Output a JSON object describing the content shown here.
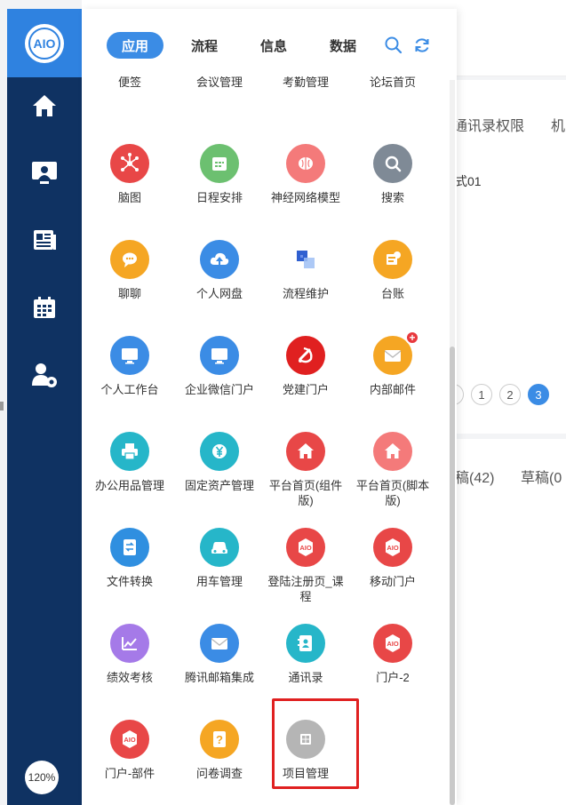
{
  "sidebar": {
    "logo_text": "AIO",
    "nav_icons": [
      "home-icon",
      "monitor-user-icon",
      "news-icon",
      "calendar-icon",
      "user-settings-icon"
    ],
    "zoom_label": "120%"
  },
  "panel": {
    "tabs": [
      {
        "label": "应用",
        "active": true
      },
      {
        "label": "流程",
        "active": false
      },
      {
        "label": "信息",
        "active": false
      },
      {
        "label": "数据",
        "active": false
      }
    ],
    "header_icons": [
      "search-icon",
      "refresh-icon"
    ],
    "apps": [
      {
        "label": "便签",
        "color": "#e8a13a",
        "icon": "note-icon"
      },
      {
        "label": "会议管理",
        "color": "#f2a93b",
        "icon": "meeting-icon"
      },
      {
        "label": "考勤管理",
        "color": "#f2a93b",
        "icon": "attendance-icon"
      },
      {
        "label": "论坛首页",
        "color": "#3fb4e8",
        "icon": "forum-icon"
      },
      {
        "label": "脑图",
        "color": "#e84747",
        "icon": "mindmap-icon"
      },
      {
        "label": "日程安排",
        "color": "#6cc070",
        "icon": "schedule-icon"
      },
      {
        "label": "神经网络模型",
        "color": "#f47a7a",
        "icon": "brain-icon"
      },
      {
        "label": "搜索",
        "color": "#7f8a96",
        "icon": "search-icon"
      },
      {
        "label": "聊聊",
        "color": "#f5a623",
        "icon": "chat-icon"
      },
      {
        "label": "个人网盘",
        "color": "#3b8ce5",
        "icon": "cloud-upload-icon"
      },
      {
        "label": "流程维护",
        "color": "transparent",
        "icon": "flow-squares-icon"
      },
      {
        "label": "台账",
        "color": "#f5a623",
        "icon": "ledger-icon"
      },
      {
        "label": "个人工作台",
        "color": "#3b8ce5",
        "icon": "monitor-icon"
      },
      {
        "label": "企业微信门户",
        "color": "#3b8ce5",
        "icon": "monitor-icon"
      },
      {
        "label": "党建门户",
        "color": "#e02020",
        "icon": "party-emblem-icon"
      },
      {
        "label": "内部邮件",
        "color": "#f5a623",
        "icon": "mail-icon",
        "badge": "+"
      },
      {
        "label": "办公用品管理",
        "color": "#26b6c9",
        "icon": "printer-icon"
      },
      {
        "label": "固定资产管理",
        "color": "#26b6c9",
        "icon": "yen-icon"
      },
      {
        "label": "平台首页(组件版)",
        "color": "#e84747",
        "icon": "home-icon"
      },
      {
        "label": "平台首页(脚本版)",
        "color": "#f47a7a",
        "icon": "home-icon"
      },
      {
        "label": "文件转换",
        "color": "#2f8fe0",
        "icon": "file-convert-icon"
      },
      {
        "label": "用车管理",
        "color": "#26b6c9",
        "icon": "car-icon"
      },
      {
        "label": "登陆注册页_课程",
        "color": "#e84747",
        "icon": "aio-icon"
      },
      {
        "label": "移动门户",
        "color": "#e84747",
        "icon": "aio-icon"
      },
      {
        "label": "绩效考核",
        "color": "#a57ae8",
        "icon": "chart-icon"
      },
      {
        "label": "腾讯邮箱集成",
        "color": "#3b8ce5",
        "icon": "mail-icon"
      },
      {
        "label": "通讯录",
        "color": "#26b6c9",
        "icon": "contacts-icon"
      },
      {
        "label": "门户-2",
        "color": "#e84747",
        "icon": "aio-icon"
      },
      {
        "label": "门户-部件",
        "color": "#e84747",
        "icon": "aio-icon"
      },
      {
        "label": "问卷调查",
        "color": "#f5a623",
        "icon": "question-icon"
      },
      {
        "label": "项目管理",
        "color": "#b5b5b5",
        "icon": "grid-icon",
        "highlighted": true
      }
    ]
  },
  "background": {
    "tab1": "通讯录权限",
    "tab2": "机",
    "row_text": "式01",
    "pager": [
      "1",
      "2",
      "3"
    ],
    "pager_active": "3",
    "tab_drafts_sent": "稿(42)",
    "tab_drafts": "草稿(0"
  }
}
